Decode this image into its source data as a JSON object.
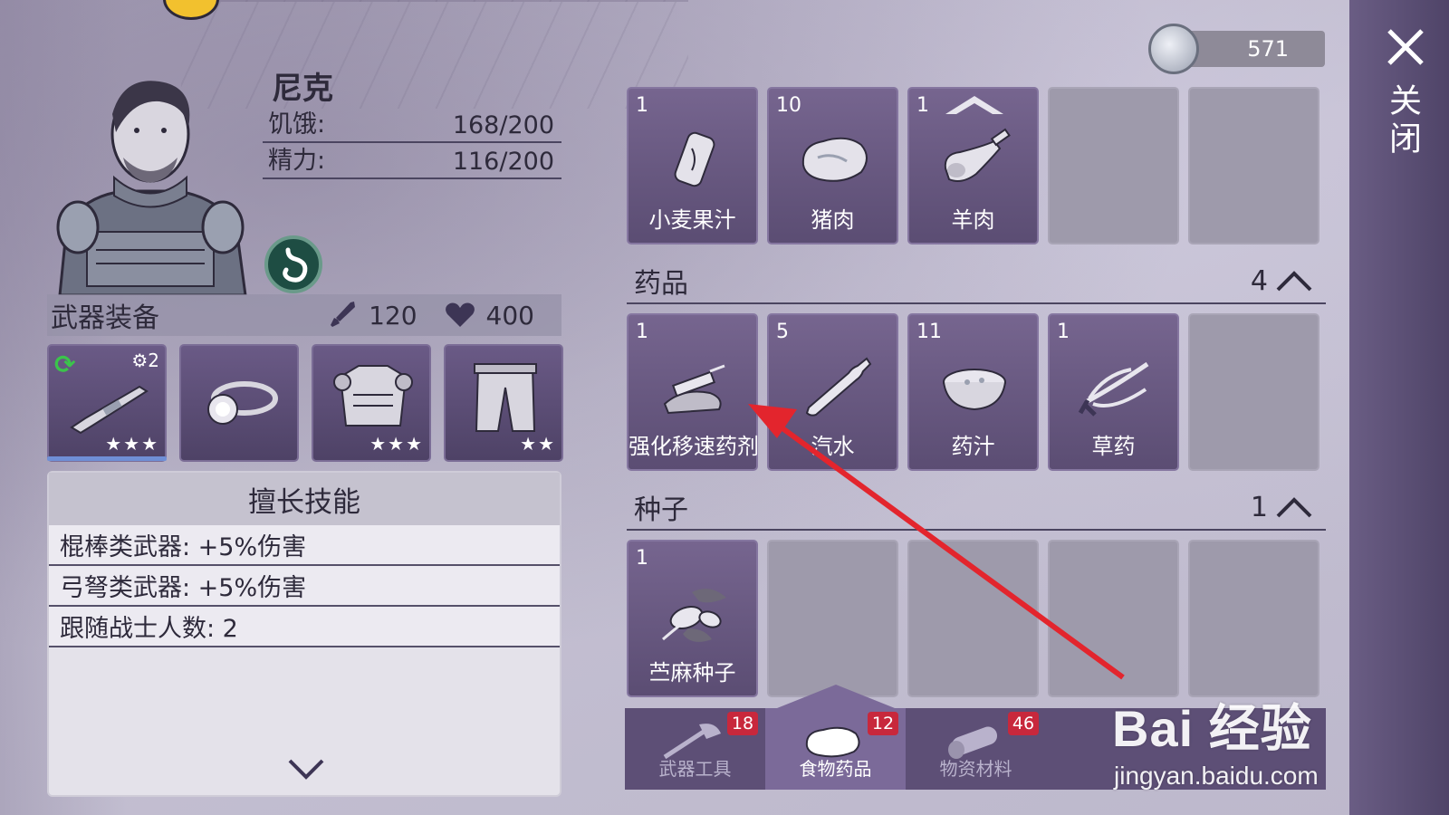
{
  "character": {
    "name": "尼克",
    "hunger_label": "饥饿:",
    "hunger_value": "168/200",
    "energy_label": "精力:",
    "energy_value": "116/200"
  },
  "equipment": {
    "title": "武器装备",
    "attack": "120",
    "health": "400",
    "slots": [
      {
        "name": "weapon-rifle",
        "stars": "★★★",
        "gear": "⚙2"
      },
      {
        "name": "headlamp",
        "stars": ""
      },
      {
        "name": "armor-vest",
        "stars": "★★★"
      },
      {
        "name": "pants",
        "stars": "★★"
      }
    ]
  },
  "skills": {
    "title": "擅长技能",
    "rows": [
      "棍棒类武器: +5%伤害",
      "弓弩类武器: +5%伤害",
      "跟随战士人数: 2"
    ]
  },
  "currency": {
    "amount": "571"
  },
  "food_items": [
    {
      "count": "1",
      "label": "小麦果汁"
    },
    {
      "count": "10",
      "label": "猪肉"
    },
    {
      "count": "1",
      "label": "羊肉"
    }
  ],
  "medicine_section": {
    "title": "药品",
    "count": "4"
  },
  "medicine_items": [
    {
      "count": "1",
      "label": "强化移速药剂"
    },
    {
      "count": "5",
      "label": "汽水"
    },
    {
      "count": "11",
      "label": "药汁"
    },
    {
      "count": "1",
      "label": "草药"
    }
  ],
  "seed_section": {
    "title": "种子",
    "count": "1"
  },
  "seed_items": [
    {
      "count": "1",
      "label": "苎麻种子"
    }
  ],
  "tabs": [
    {
      "label": "武器工具",
      "badge": "18"
    },
    {
      "label": "食物药品",
      "badge": "12"
    },
    {
      "label": "物资材料",
      "badge": "46"
    }
  ],
  "close_label": "关闭",
  "watermark": {
    "main": "Bai 经验",
    "sub": "jingyan.baidu.com"
  },
  "colors": {
    "accent_red": "#e3252d",
    "badge_red": "#c8283c",
    "slot_purple": "#5b4d73"
  }
}
